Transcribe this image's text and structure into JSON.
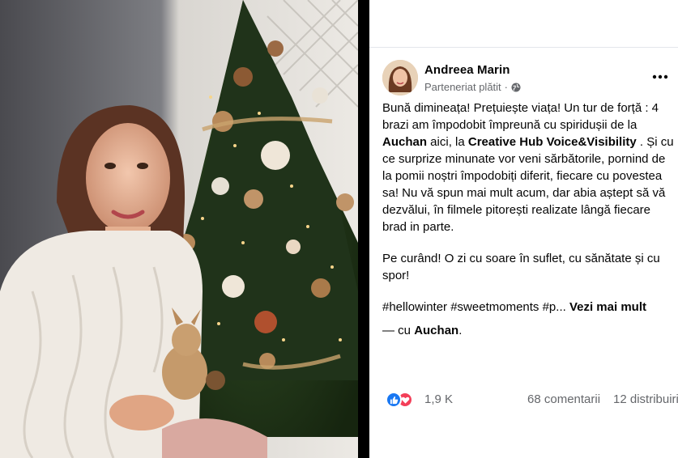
{
  "post": {
    "author": "Andreea Marin",
    "meta_label": "Parteneriat plătit",
    "meta_separator": "·",
    "body": {
      "p1_a": "Bună dimineața! Prețuiește viața! Un tur de forță : 4 brazi am împodobit împreună cu spiridușii de la ",
      "p1_link1": "Auchan",
      "p1_b": " aici, la ",
      "p1_link2": "Creative Hub Voice&Visibility",
      "p1_c": " . Și cu ce surprize minunate vor veni sărbătorile, pornind de la pomii noștri împodobiți diferit, fiecare cu povestea sa! Nu vă spun mai mult acum, dar abia aștept să vă dezvălui, în filmele pitorești realizate lângă fiecare brad in parte.",
      "p2": "Pe curând! O zi cu soare în suflet, cu sănătate și cu spor!",
      "p3_tags": "#hellowinter #sweetmoments #p... ",
      "p3_see_more": "Vezi mai mult",
      "with_prefix": "— cu ",
      "with_name": "Auchan",
      "with_suffix": "."
    },
    "reactions": {
      "count": "1,9 K",
      "comments": "68 comentarii",
      "shares": "12 distribuiri",
      "icons": [
        "like-icon",
        "love-icon"
      ]
    }
  },
  "colors": {
    "link_blue": "#1877f2",
    "love_red": "#f33e58",
    "secondary_text": "#65676b"
  }
}
